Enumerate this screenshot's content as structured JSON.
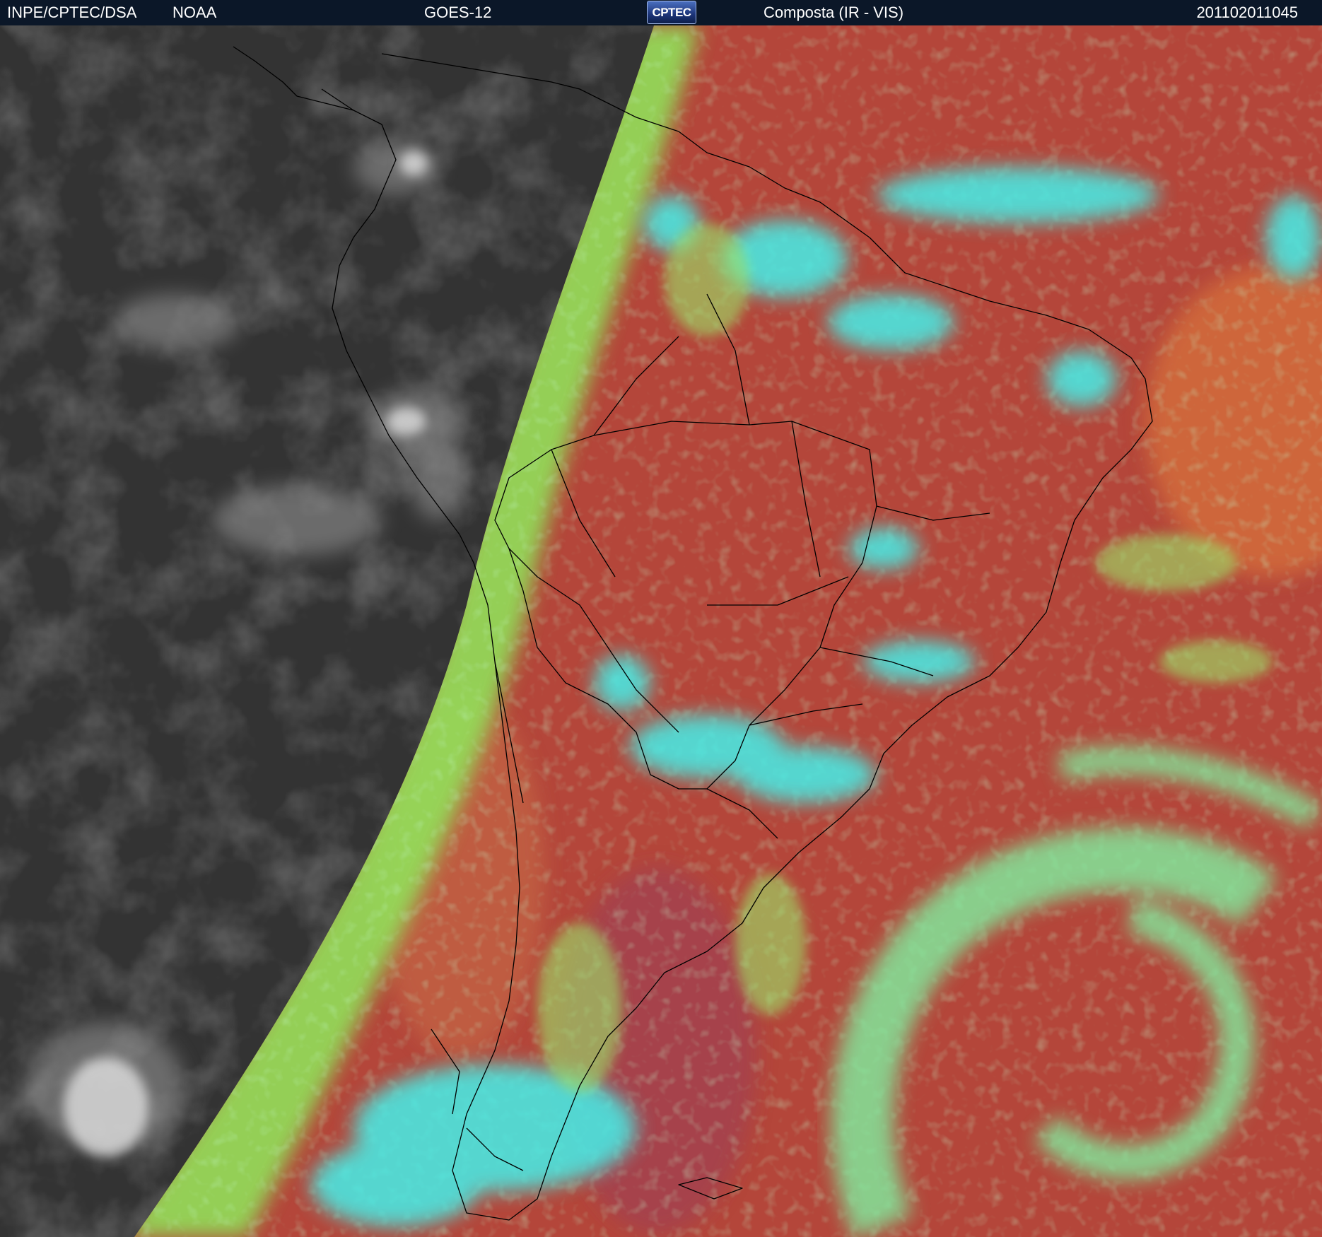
{
  "header": {
    "organization": "INPE/CPTEC/DSA",
    "agency": "NOAA",
    "satellite": "GOES-12",
    "logo_text": "CPTEC",
    "product": "Composta (IR - VIS)",
    "timestamp": "201102011045"
  },
  "colors": {
    "header_bg": "#0b1728",
    "night_side_gray": "#3a3a3a",
    "ocean_red": "#b5453a",
    "land_red": "#a84538",
    "cloud_cyan": "#40f0f0",
    "cloud_green": "#8ee870",
    "border_lines": "#000000"
  }
}
